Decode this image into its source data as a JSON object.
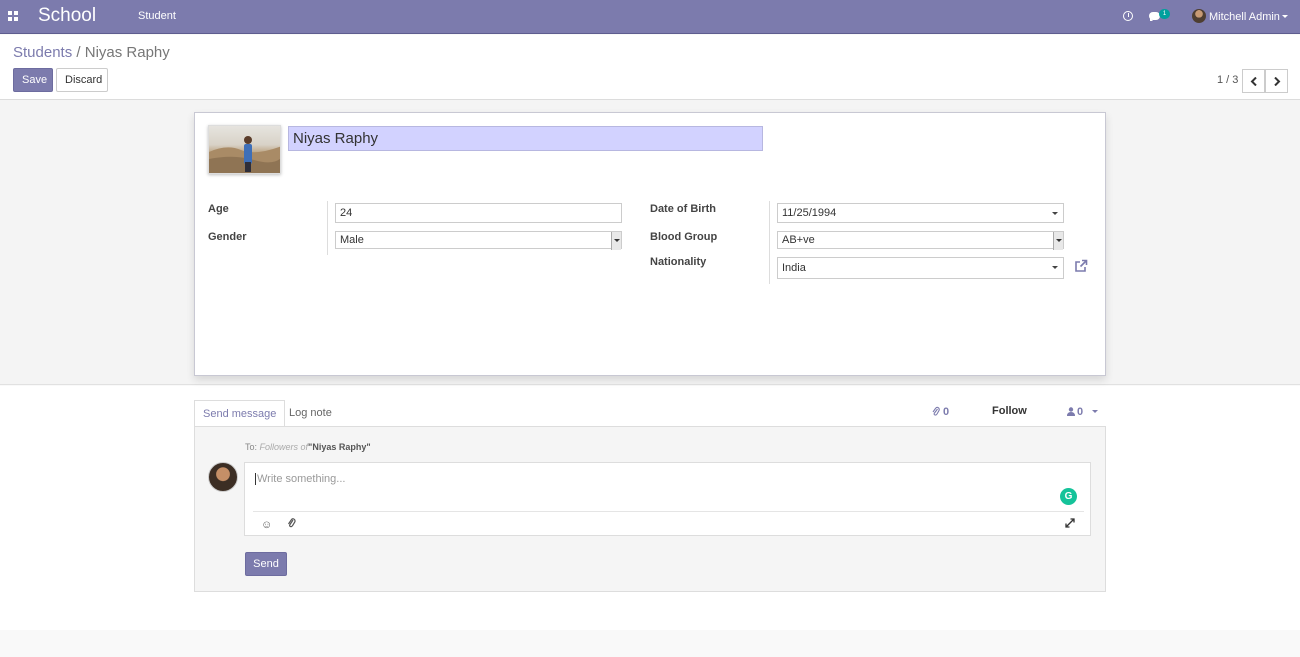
{
  "navbar": {
    "brand": "School",
    "menu_item": "Student",
    "chat_badge": "1",
    "user_name": "Mitchell Admin"
  },
  "breadcrumb": {
    "parent": "Students",
    "separator": "/",
    "current": "Niyas Raphy"
  },
  "toolbar": {
    "save_label": "Save",
    "discard_label": "Discard"
  },
  "pager": {
    "value": "1 / 3"
  },
  "form": {
    "name": "Niyas Raphy",
    "left": [
      {
        "label": "Age",
        "value": "24"
      },
      {
        "label": "Gender",
        "value": "Male"
      }
    ],
    "right": [
      {
        "label": "Date of Birth",
        "value": "11/25/1994"
      },
      {
        "label": "Blood Group",
        "value": "AB+ve"
      },
      {
        "label": "Nationality",
        "value": "India"
      }
    ]
  },
  "chatter": {
    "tabs": [
      "Send message",
      "Log note"
    ],
    "attachments": "0",
    "follow_label": "Follow",
    "followers": "0",
    "to_prefix": "To:",
    "to_followers": "Followers of",
    "to_record": "\"Niyas Raphy\"",
    "placeholder": "Write something...",
    "send_label": "Send"
  },
  "colors": {
    "brand": "#7c7bad",
    "name_highlight": "#d2d2ff",
    "grammarly": "#15c39a"
  }
}
